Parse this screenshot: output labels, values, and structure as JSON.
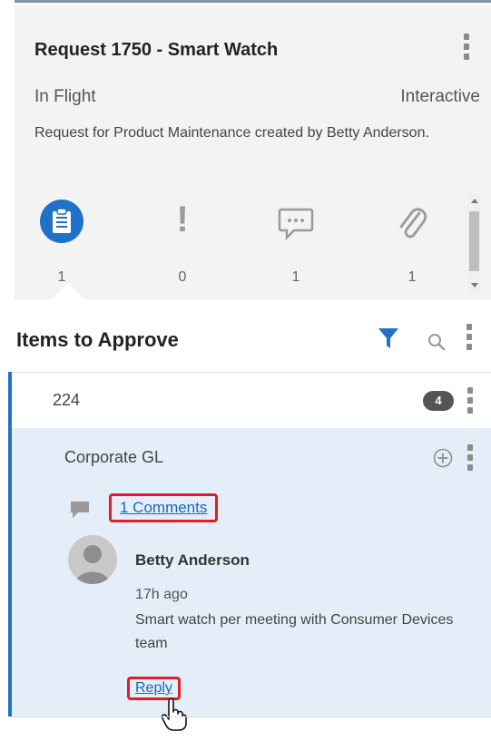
{
  "request": {
    "title": "Request 1750 - Smart Watch",
    "status": "In Flight",
    "mode": "Interactive",
    "description": "Request for Product Maintenance created by Betty Anderson."
  },
  "tabs": [
    {
      "icon": "clipboard-icon",
      "count": "1",
      "active": true
    },
    {
      "icon": "exclamation-icon",
      "count": "0",
      "active": false
    },
    {
      "icon": "comment-icon",
      "count": "1",
      "active": false
    },
    {
      "icon": "paperclip-icon",
      "count": "1",
      "active": false
    }
  ],
  "section": {
    "title": "Items to Approve"
  },
  "group": {
    "id": "224",
    "badge": "4",
    "item_name": "Corporate GL",
    "comments_link": "1 Comments",
    "comment": {
      "author": "Betty Anderson",
      "age": "17h ago",
      "text": "Smart watch per meeting with Consumer Devices team",
      "reply": "Reply"
    }
  },
  "colors": {
    "accent": "#1f72c7",
    "highlight": "#e01e23",
    "selected_background": "#e3eef8",
    "card_background": "#f3f3f3"
  }
}
